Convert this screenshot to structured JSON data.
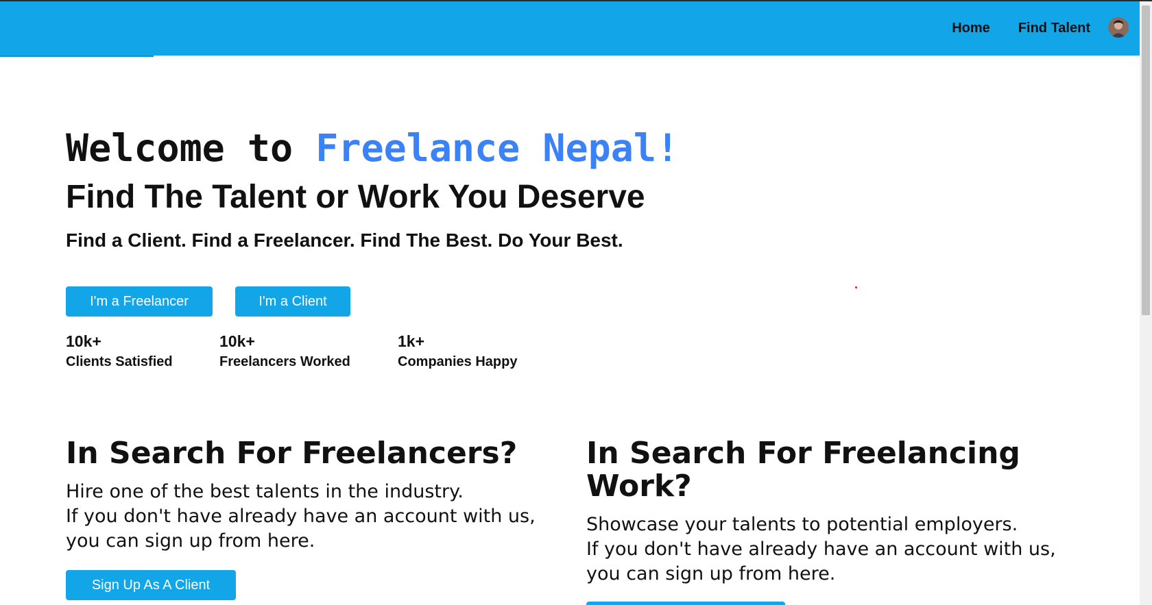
{
  "nav": {
    "links": [
      {
        "label": "Home"
      },
      {
        "label": "Find Talent"
      }
    ]
  },
  "hero": {
    "welcome_prefix": "Welcome to ",
    "welcome_brand": "Freelance Nepal!",
    "headline": "Find The Talent or Work You Deserve",
    "tagline": "Find a Client. Find a Freelancer. Find The Best. Do Your Best.",
    "buttons": {
      "freelancer": "I'm a Freelancer",
      "client": "I'm a Client"
    },
    "stats": [
      {
        "value": "10k+",
        "label": "Clients Satisfied"
      },
      {
        "value": "10k+",
        "label": "Freelancers Worked"
      },
      {
        "value": "1k+",
        "label": "Companies Happy"
      }
    ]
  },
  "client_section": {
    "title": "In Search For Freelancers?",
    "body": "Hire one of the best talents in the industry.\nIf you don't have already have an account with us,\nyou can sign up from here.",
    "button": "Sign Up As A Client"
  },
  "freelancer_section": {
    "title": "In Search For Freelancing Work?",
    "body": "Showcase your talents to potential employers.\nIf you don't have already have an account with us,\nyou can sign up from here."
  },
  "colors": {
    "navbar": "#12a5e8",
    "brand_text": "#3b82f6",
    "button": "#12a5e8"
  }
}
